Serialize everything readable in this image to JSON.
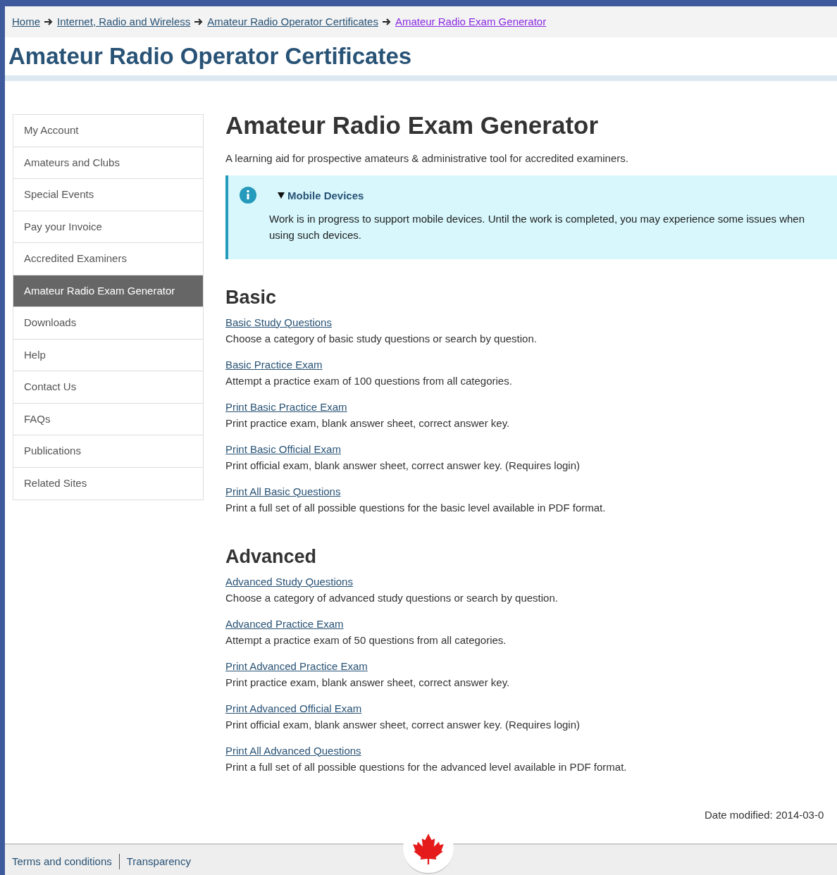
{
  "breadcrumbs": [
    {
      "label": "Home",
      "current": false
    },
    {
      "label": "Internet, Radio and Wireless",
      "current": false
    },
    {
      "label": "Amateur Radio Operator Certificates",
      "current": false
    },
    {
      "label": "Amateur Radio Exam Generator",
      "current": true
    }
  ],
  "site_title": "Amateur Radio Operator Certificates",
  "sidebar": {
    "items": [
      {
        "label": "My Account",
        "selected": false
      },
      {
        "label": "Amateurs and Clubs",
        "selected": false
      },
      {
        "label": "Special Events",
        "selected": false
      },
      {
        "label": "Pay your Invoice",
        "selected": false
      },
      {
        "label": "Accredited Examiners",
        "selected": false
      },
      {
        "label": "Amateur Radio Exam Generator",
        "selected": true
      },
      {
        "label": "Downloads",
        "selected": false
      },
      {
        "label": "Help",
        "selected": false
      },
      {
        "label": "Contact Us",
        "selected": false
      },
      {
        "label": "FAQs",
        "selected": false
      },
      {
        "label": "Publications",
        "selected": false
      },
      {
        "label": "Related Sites",
        "selected": false
      }
    ]
  },
  "page_title": "Amateur Radio Exam Generator",
  "intro": "A learning aid for prospective amateurs & administrative tool for accredited examiners.",
  "notice": {
    "title": "Mobile Devices",
    "expanded": true,
    "text": "Work is in progress to support mobile devices. Until the work is completed, you may experience some issues when using such devices."
  },
  "sections": [
    {
      "heading": "Basic",
      "links": [
        {
          "label": "Basic Study Questions",
          "description": "Choose a category of basic study questions or search by question."
        },
        {
          "label": "Basic Practice Exam",
          "description": "Attempt a practice exam of 100 questions from all categories."
        },
        {
          "label": "Print Basic Practice Exam",
          "description": "Print practice exam, blank answer sheet, correct answer key."
        },
        {
          "label": "Print Basic Official Exam",
          "description": "Print official exam, blank answer sheet, correct answer key. (Requires login)"
        },
        {
          "label": "Print All Basic Questions",
          "description": "Print a full set of all possible questions for the basic level available in PDF format."
        }
      ]
    },
    {
      "heading": "Advanced",
      "links": [
        {
          "label": "Advanced Study Questions",
          "description": "Choose a category of advanced study questions or search by question."
        },
        {
          "label": "Advanced Practice Exam",
          "description": "Attempt a practice exam of 50 questions from all categories."
        },
        {
          "label": "Print Advanced Practice Exam",
          "description": "Print practice exam, blank answer sheet, correct answer key."
        },
        {
          "label": "Print Advanced Official Exam",
          "description": "Print official exam, blank answer sheet, correct answer key. (Requires login)"
        },
        {
          "label": "Print All Advanced Questions",
          "description": "Print a full set of all possible questions for the advanced level available in PDF format."
        }
      ]
    }
  ],
  "date_modified": "Date modified: 2014-03-0",
  "footer_links": [
    "Terms and conditions",
    "Transparency"
  ]
}
